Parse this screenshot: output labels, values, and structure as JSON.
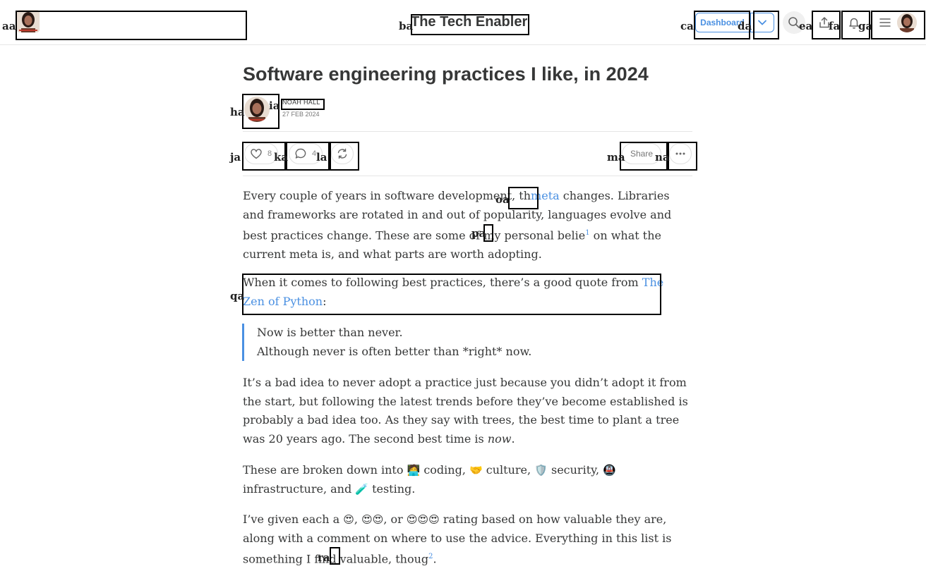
{
  "header": {
    "publication_title": "The Tech Enabler",
    "dashboard_label": "Dashboard"
  },
  "overlay_labels": {
    "aa": "aa",
    "ba": "ba",
    "ca": "ca",
    "da": "da",
    "ea": "ea",
    "fa": "fa",
    "ga": "ga",
    "ha": "ha",
    "ia": "ia",
    "ja": "ja",
    "ka": "ka",
    "la": "la",
    "ma": "ma",
    "na": "na",
    "oa": "oa",
    "pa": "pa",
    "qa": "qa",
    "ra": "ra"
  },
  "post": {
    "title": "Software engineering practices I like, in 2024",
    "author": "NOAH HALL",
    "date": "27 FEB 2024",
    "like_count": "8",
    "comment_count": "4",
    "share_label": "Share"
  },
  "content": {
    "p1_a": "Every couple of years in software development, th",
    "p1_link": "meta",
    "p1_b": " changes. Libraries and frameworks are rotated in and out of popularity, languages evolve and best practices change. These are some of my personal belie",
    "p1_fn": "1",
    "p1_c": " on what the current meta is, and what parts are worth adopting.",
    "p2_a": "When it comes to following best practices, there’s a good quote from ",
    "p2_link": "The Zen of Python",
    "p2_b": ":",
    "quote_line1": "Now is better than never.",
    "quote_line2": "Although never is often better than *right* now.",
    "p3_a": "It’s a bad idea to never adopt a practice just because you didn’t adopt it from the start, but following the latest trends before they’ve become established is probably a bad idea too. As they say with trees, the best time to plant a tree was 20 years ago. The second best time is ",
    "p3_em": "now",
    "p3_b": ".",
    "p4_a": "These are broken down into ",
    "p4_coding": "🧑‍💻",
    "p4_b": " coding, ",
    "p4_culture": "🤝",
    "p4_c": " culture, ",
    "p4_security": "🛡️",
    "p4_d": " security, ",
    "p4_infra": "🚇",
    "p4_e": " infrastructure, and",
    "p4_testing": "🧪",
    "p4_f": " testing.",
    "p5_a": "I’ve given each a ",
    "p5_r1": "😍",
    "p5_b": ", ",
    "p5_r2": "😍😍",
    "p5_c": ", or ",
    "p5_r3": "😍😍😍",
    "p5_d": " rating based on how valuable they are, along with a comment on where to use the advice. Everything in this list is something I find valuable, thoug",
    "p5_fn": "2",
    "p5_e": "."
  },
  "colors": {
    "accent": "#4a90e2",
    "text": "#363737",
    "border": "#e6e6e6"
  },
  "icons": [
    "search-icon",
    "share-icon",
    "bell-icon",
    "menu-icon",
    "heart-icon",
    "comment-icon",
    "restack-icon",
    "more-icon",
    "chevron-down-icon"
  ]
}
